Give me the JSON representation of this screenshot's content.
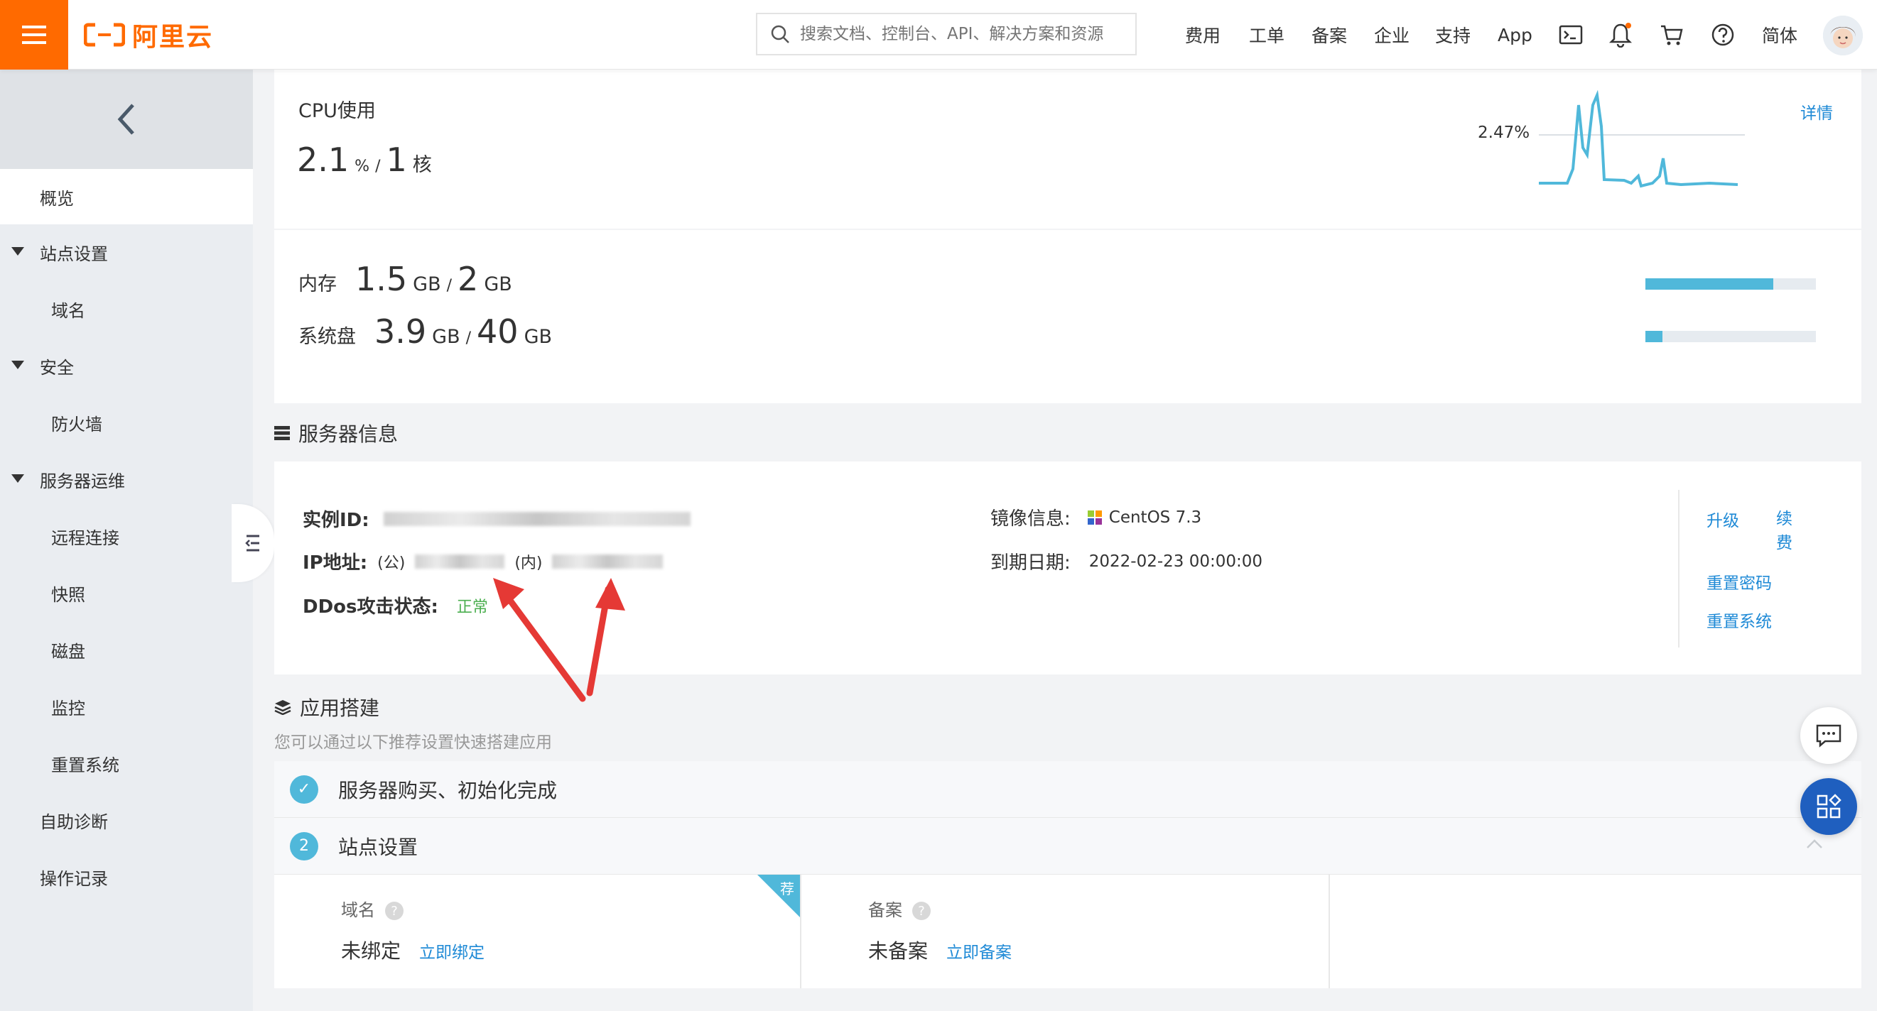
{
  "header": {
    "logo_text": "阿里云",
    "search_placeholder": "搜索文档、控制台、API、解决方案和资源",
    "nav": [
      "费用",
      "工单",
      "备案",
      "企业",
      "支持",
      "App"
    ],
    "lang": "简体",
    "icons": [
      "terminal-icon",
      "bell-icon",
      "cart-icon",
      "help-icon"
    ]
  },
  "sidebar": {
    "items": [
      {
        "label": "概览",
        "level": 0,
        "active": true
      },
      {
        "label": "站点设置",
        "level": 0,
        "expanded": true
      },
      {
        "label": "域名",
        "level": 1
      },
      {
        "label": "安全",
        "level": 0,
        "expanded": true
      },
      {
        "label": "防火墙",
        "level": 1
      },
      {
        "label": "服务器运维",
        "level": 0,
        "expanded": true
      },
      {
        "label": "远程连接",
        "level": 1
      },
      {
        "label": "快照",
        "level": 1
      },
      {
        "label": "磁盘",
        "level": 1
      },
      {
        "label": "监控",
        "level": 1
      },
      {
        "label": "重置系统",
        "level": 1
      },
      {
        "label": "自助诊断",
        "level": 0
      },
      {
        "label": "操作记录",
        "level": 0
      }
    ]
  },
  "cpu": {
    "title": "CPU使用",
    "value": "2.1",
    "unit": "%",
    "sep": "/",
    "cores": "1",
    "cores_unit": "核",
    "current": "2.47%",
    "detail_link": "详情"
  },
  "resources": {
    "memory": {
      "label": "内存",
      "used": "1.5",
      "used_unit": "GB",
      "sep": "/",
      "total": "2",
      "total_unit": "GB",
      "ratio": 0.75
    },
    "disk": {
      "label": "系统盘",
      "used": "3.9",
      "used_unit": "GB",
      "sep": "/",
      "total": "40",
      "total_unit": "GB",
      "ratio": 0.1
    }
  },
  "server_info": {
    "section_title": "服务器信息",
    "instance_label": "实例ID:",
    "ip_label": "IP地址:",
    "ip_public_prefix": "(公)",
    "ip_private_prefix": "(内)",
    "ddos_label": "DDos攻击状态:",
    "ddos_value": "正常",
    "image_label": "镜像信息:",
    "image_value": "CentOS 7.3",
    "expire_label": "到期日期:",
    "expire_value": "2022-02-23 00:00:00",
    "actions": [
      "升级",
      "续费",
      "重置密码",
      "重置系统"
    ]
  },
  "app_build": {
    "section_title": "应用搭建",
    "subtitle": "您可以通过以下推荐设置快速搭建应用",
    "steps": [
      {
        "num": "✓",
        "title": "服务器购买、初始化完成"
      },
      {
        "num": "2",
        "title": "站点设置"
      }
    ],
    "domain": {
      "label": "域名",
      "status": "未绑定",
      "action": "立即绑定",
      "badge": "荐"
    },
    "beian": {
      "label": "备案",
      "status": "未备案",
      "action": "立即备案"
    }
  },
  "colors": {
    "brand": "#ff6a00",
    "link": "#1f8ad6",
    "accent": "#50b8da",
    "ok": "#4caf50"
  }
}
